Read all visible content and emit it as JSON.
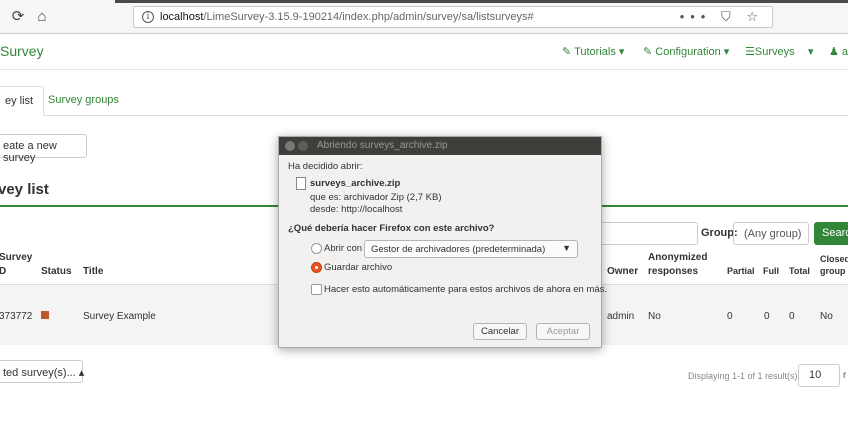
{
  "browser": {
    "url_host": "localhost",
    "url_path": "/LimeSurvey-3.15.9-190214/index.php/admin/survey/sa/listsurveys#",
    "url_actions": "••• ⛉ ☆"
  },
  "app": {
    "brand": "Survey",
    "nav": {
      "tutorials": "✎ Tutorials ▾",
      "configuration": "✎ Configuration ▾",
      "surveys": "☰Surveys",
      "surveys_caret": "▾",
      "user": "♟ ac"
    },
    "tabs": [
      "ey list",
      "Survey groups"
    ],
    "create_button": "eate a new survey",
    "section_title": "vey list",
    "filter": {
      "group_label": "Group:",
      "group_value": "(Any group)",
      "search_button": "Searc"
    },
    "table": {
      "headers": {
        "survey_id_line1": "Survey",
        "survey_id_line2": "D",
        "status": "Status",
        "title": "Title",
        "owner": "Owner",
        "anon_line1": "Anonymized",
        "anon_line2": "responses",
        "partial": "Partial",
        "full": "Full",
        "total": "Total",
        "closed_line1": "Closed",
        "closed_line2": "group"
      },
      "rows": [
        {
          "id": "373772",
          "status_color": "#c0562b",
          "title": "Survey Example",
          "owner": "admin",
          "anonymized": "No",
          "partial": "0",
          "full": "0",
          "total": "0",
          "closed": "No"
        }
      ]
    },
    "selected_button": "ted survey(s)... ▴",
    "pagination": {
      "displaying": "Displaying 1-1 of 1 result(s).",
      "page_size": "10",
      "suffix": "r"
    }
  },
  "dialog": {
    "title": "Abriendo surveys_archive.zip",
    "intro": "Ha decidido abrir:",
    "filename": "surveys_archive.zip",
    "type_line": "que es:  archivador Zip (2,7 KB)",
    "from_line": "desde:  http://localhost",
    "question": "¿Qué debería hacer Firefox con este archivo?",
    "open_with_label": "Abrir con",
    "open_with_app": "Gestor de archivadores (predeterminada)",
    "save_label": "Guardar archivo",
    "auto_label": "Hacer esto automáticamente para estos archivos de ahora en más.",
    "cancel": "Cancelar",
    "accept": "Aceptar"
  }
}
